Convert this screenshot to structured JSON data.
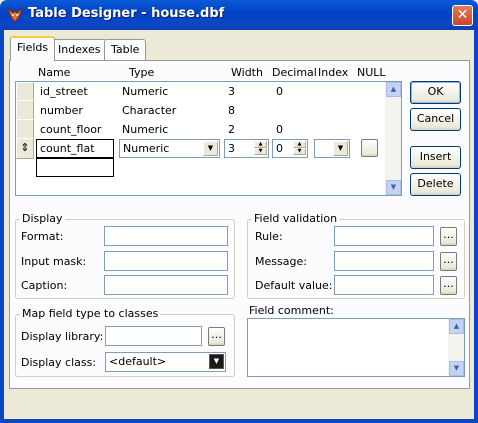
{
  "window": {
    "title": "Table Designer - house.dbf",
    "close_glyph": "✕"
  },
  "tabs": [
    {
      "label": "Fields",
      "active": true
    },
    {
      "label": "Indexes",
      "active": false
    },
    {
      "label": "Table",
      "active": false
    }
  ],
  "grid": {
    "columns": [
      "Name",
      "Type",
      "Width",
      "Decimal",
      "Index",
      "NULL"
    ],
    "rows": [
      {
        "name": "id_street",
        "type": "Numeric",
        "width": "3",
        "decimal": "0"
      },
      {
        "name": "number",
        "type": "Character",
        "width": "8",
        "decimal": ""
      },
      {
        "name": "count_floor",
        "type": "Numeric",
        "width": "2",
        "decimal": "0"
      }
    ],
    "edit_row": {
      "name": "count_flat",
      "type": "Numeric",
      "width": "3",
      "decimal": "0",
      "index": "",
      "row_marker": "⇕"
    }
  },
  "buttons": {
    "ok": "OK",
    "cancel": "Cancel",
    "insert": "Insert",
    "delete": "Delete",
    "ellipsis": "..."
  },
  "display_group": {
    "title": "Display",
    "format_label": "Format:",
    "input_mask_label": "Input mask:",
    "caption_label": "Caption:",
    "format_value": "",
    "input_mask_value": "",
    "caption_value": ""
  },
  "validation_group": {
    "title": "Field validation",
    "rule_label": "Rule:",
    "message_label": "Message:",
    "default_label": "Default value:"
  },
  "map_group": {
    "title": "Map field type to classes",
    "library_label": "Display library:",
    "class_label": "Display class:",
    "class_value": "<default>"
  },
  "comment": {
    "label": "Field comment:",
    "value": ""
  },
  "colors": {
    "title_bar": "#0b47c4",
    "tab_highlight": "#ffc83c",
    "panel": "#fcfcfe",
    "chrome": "#ece9d8"
  }
}
